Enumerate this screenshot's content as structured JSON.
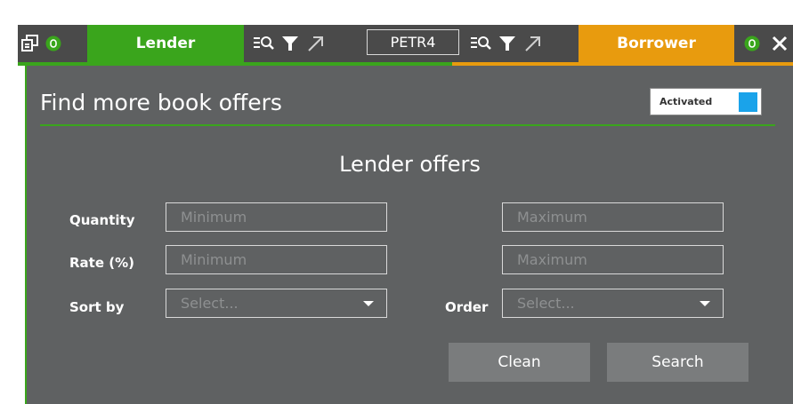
{
  "tabs": {
    "lender_label": "Lender",
    "borrower_label": "Borrower",
    "ticker_value": "PETR4"
  },
  "icons": [
    "popout-icon",
    "toggle-icon",
    "search-list-icon",
    "filter-icon",
    "expand-arrow-icon",
    "close-icon"
  ],
  "colors": {
    "lender_accent": "#3aa51c",
    "borrower_accent": "#e89b0e",
    "tabbar_bg": "#4a4a4a",
    "panel_bg": "#5f6162",
    "switch_on": "#1aa3ea"
  },
  "panel": {
    "title": "Find more book offers",
    "activated_label": "Activated",
    "activated_on": true,
    "section_title": "Lender offers"
  },
  "form": {
    "quantity_label": "Quantity",
    "rate_label": "Rate (%)",
    "sort_label": "Sort by",
    "order_label": "Order",
    "min_placeholder": "Minimum",
    "max_placeholder": "Maximum",
    "select_placeholder": "Select..."
  },
  "buttons": {
    "clean_label": "Clean",
    "search_label": "Search"
  }
}
